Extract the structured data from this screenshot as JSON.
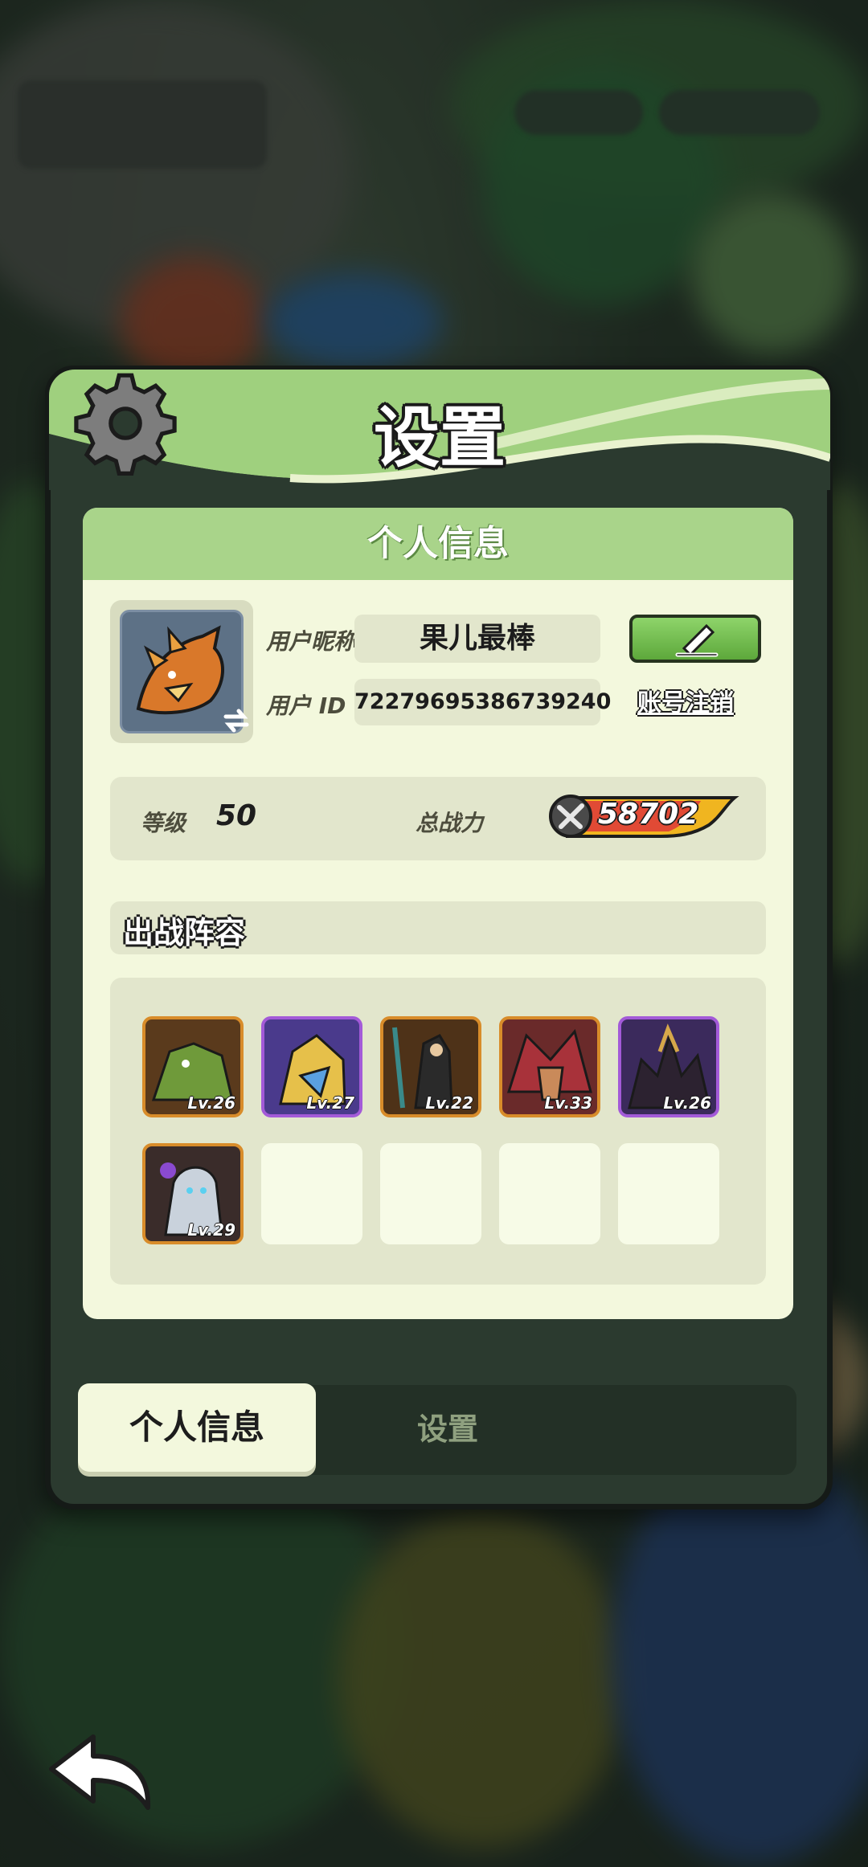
{
  "panel": {
    "title": "设置"
  },
  "profile": {
    "section_title": "个人信息",
    "nickname_label": "用户昵称",
    "nickname": "果儿最棒",
    "id_label": "用户 ID",
    "user_id": "72279695386739240",
    "cancel_account": "账号注销"
  },
  "stats": {
    "level_label": "等级",
    "level": "50",
    "power_label": "总战力",
    "power": "58702"
  },
  "lineup": {
    "title": "出战阵容",
    "heroes": [
      {
        "level": "Lv.26",
        "rarity": "orange",
        "color": "#5a3a1c"
      },
      {
        "level": "Lv.27",
        "rarity": "purple",
        "color": "#4a3a8c"
      },
      {
        "level": "Lv.22",
        "rarity": "orange",
        "color": "#4e3218"
      },
      {
        "level": "Lv.33",
        "rarity": "orange",
        "color": "#6a2a2a"
      },
      {
        "level": "Lv.26",
        "rarity": "purple",
        "color": "#3b2a5c"
      },
      {
        "level": "Lv.29",
        "rarity": "orange",
        "color": "#3a2c2a"
      }
    ]
  },
  "tabs": {
    "active": "个人信息",
    "inactive": "设置"
  },
  "colors": {
    "accent_green": "#a9d48a",
    "card_bg": "#f3f8dd",
    "orange_frame": "#d88c2a",
    "purple_frame": "#a35ad8"
  }
}
